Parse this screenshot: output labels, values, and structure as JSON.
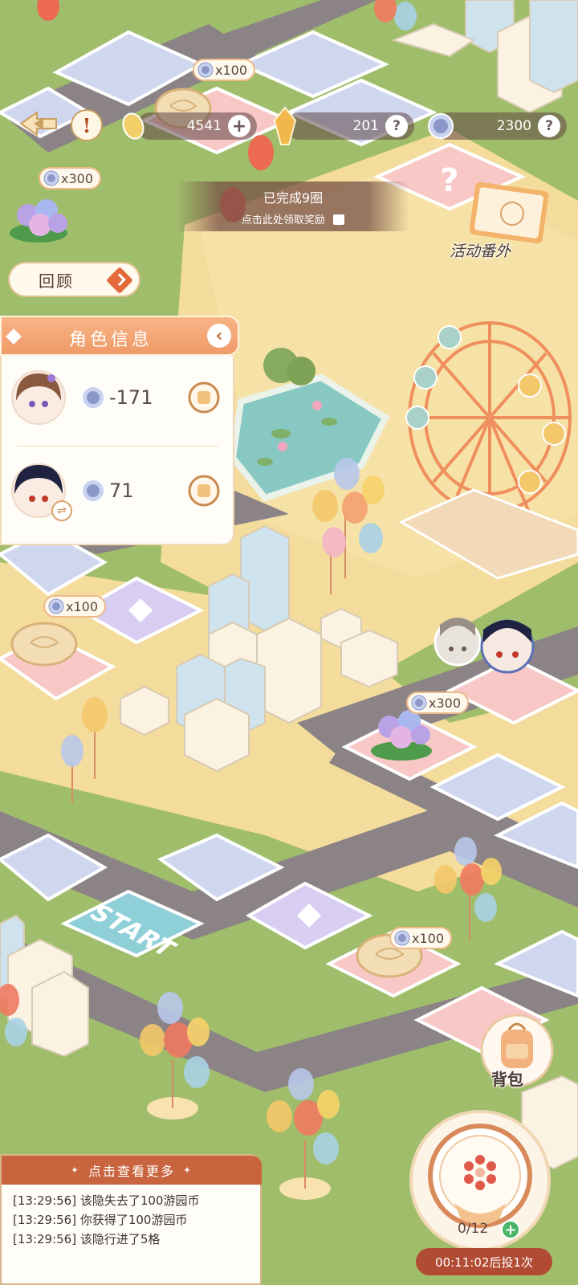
{
  "hud": {
    "mooncake_count": "4541",
    "crystal_count": "201",
    "coin_count": "2300"
  },
  "rounds_banner": {
    "title": "已完成9圈",
    "subtitle": "点击此处领取奖励"
  },
  "activity_extra": {
    "label": "活动番外"
  },
  "review_button": {
    "label": "回顾"
  },
  "character_panel": {
    "title": "角色信息",
    "characters": [
      {
        "score": "-171"
      },
      {
        "score": "71"
      }
    ]
  },
  "board_rewards": {
    "tile_top_mooncake": "x100",
    "tile_left_flower": "x300",
    "tile_left_mooncake": "x100",
    "tile_right_flower": "x300",
    "tile_bottom_mooncake": "x100"
  },
  "board": {
    "start_label": "START"
  },
  "backpack": {
    "label": "背包"
  },
  "dice": {
    "count": "0/12",
    "timer": "00:11:02后投1次"
  },
  "log": {
    "header": "点击查看更多",
    "lines": [
      "[13:29:56] 该隐失去了100游园币",
      "[13:29:56] 你获得了100游园币",
      "[13:29:56] 该隐行进了5格"
    ]
  },
  "colors": {
    "grass": "#9fbd6a",
    "road": "#8a8285",
    "plaza": "#f7e2a2",
    "tile_blue": "#cdd6ef",
    "tile_pink": "#f6c6c4",
    "tile_purple": "#d7cdf0",
    "accent_orange": "#ef9a68",
    "log_header": "#c8643e",
    "timer_red": "#b24b34"
  }
}
